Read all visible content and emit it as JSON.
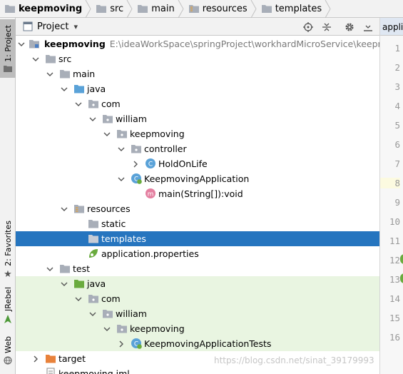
{
  "breadcrumb": [
    "keepmoving",
    "src",
    "main",
    "resources",
    "templates"
  ],
  "left_tabs": {
    "project": "1: Project",
    "favorites": "2: Favorites",
    "jrebel": "JRebel",
    "web": "Web"
  },
  "panel": {
    "title": "Project",
    "dropdown": "▾"
  },
  "tree": [
    {
      "label": "keepmoving",
      "path": "E:\\ideaWorkSpace\\springProject\\workhardMicroService\\keepmoving"
    },
    {
      "label": "src"
    },
    {
      "label": "main"
    },
    {
      "label": "java"
    },
    {
      "label": "com"
    },
    {
      "label": "william"
    },
    {
      "label": "keepmoving"
    },
    {
      "label": "controller"
    },
    {
      "label": "HoldOnLife"
    },
    {
      "label": "KeepmovingApplication"
    },
    {
      "label": "main(String[]):void"
    },
    {
      "label": "resources"
    },
    {
      "label": "static"
    },
    {
      "label": "templates"
    },
    {
      "label": "application.properties"
    },
    {
      "label": "test"
    },
    {
      "label": "java"
    },
    {
      "label": "com"
    },
    {
      "label": "william"
    },
    {
      "label": "keepmoving"
    },
    {
      "label": "KeepmovingApplicationTests"
    },
    {
      "label": "target"
    },
    {
      "label": "keepmoving.iml"
    }
  ],
  "editor": {
    "tab": "applica",
    "line_numbers": [
      "1",
      "2",
      "3",
      "4",
      "5",
      "6",
      "7",
      "8",
      "9",
      "10",
      "11",
      "12",
      "13",
      "14",
      "15",
      "16"
    ],
    "current_line": "8"
  },
  "watermark": "https://blog.csdn.net/sinat_39179993",
  "colors": {
    "selection": "#2675bf",
    "folder": "#a8aeb8",
    "source_folder": "#5aa2d8",
    "test_folder": "#6aab3e",
    "excluded_folder": "#e8823b",
    "test_background": "#e9f5e1"
  }
}
